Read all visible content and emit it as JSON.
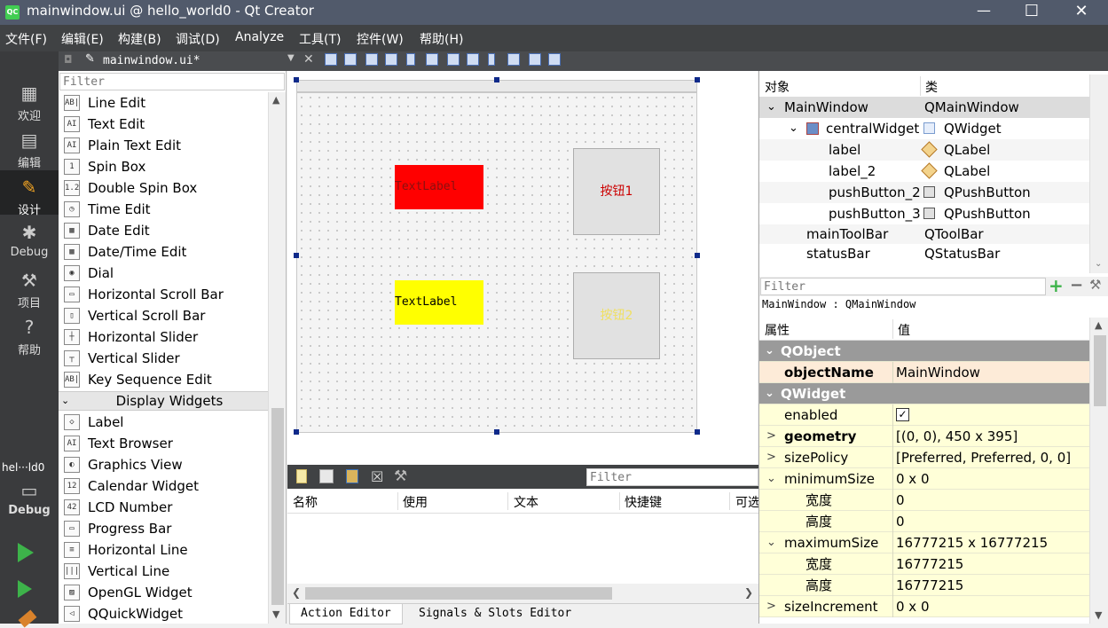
{
  "window": {
    "title": "mainwindow.ui @ hello_world0 - Qt Creator",
    "logo": "QC"
  },
  "menu": [
    "文件(F)",
    "编辑(E)",
    "构建(B)",
    "调试(D)",
    "Analyze",
    "工具(T)",
    "控件(W)",
    "帮助(H)"
  ],
  "modes": [
    {
      "label": "欢迎",
      "icon": "grid-icon"
    },
    {
      "label": "编辑",
      "icon": "document-icon"
    },
    {
      "label": "设计",
      "icon": "pencil-icon"
    },
    {
      "label": "Debug",
      "icon": "bug-icon"
    },
    {
      "label": "项目",
      "icon": "wrench-icon"
    },
    {
      "label": "帮助",
      "icon": "help-icon"
    }
  ],
  "session": {
    "name": "hel···ld0",
    "mode": "Debug"
  },
  "file_tab": {
    "name": "mainwindow.ui*"
  },
  "widgetbox": {
    "filter_placeholder": "Filter",
    "items": [
      {
        "label": "Line Edit",
        "icon": "AB|"
      },
      {
        "label": "Text Edit",
        "icon": "AI"
      },
      {
        "label": "Plain Text Edit",
        "icon": "AI"
      },
      {
        "label": "Spin Box",
        "icon": "1"
      },
      {
        "label": "Double Spin Box",
        "icon": "1.2"
      },
      {
        "label": "Time Edit",
        "icon": "◷"
      },
      {
        "label": "Date Edit",
        "icon": "▦"
      },
      {
        "label": "Date/Time Edit",
        "icon": "▦"
      },
      {
        "label": "Dial",
        "icon": "◉"
      },
      {
        "label": "Horizontal Scroll Bar",
        "icon": "▭"
      },
      {
        "label": "Vertical Scroll Bar",
        "icon": "▯"
      },
      {
        "label": "Horizontal Slider",
        "icon": "┼"
      },
      {
        "label": "Vertical Slider",
        "icon": "┬"
      },
      {
        "label": "Key Sequence Edit",
        "icon": "AB|"
      }
    ],
    "section_title": "Display Widgets",
    "display_items": [
      {
        "label": "Label",
        "icon": "◇"
      },
      {
        "label": "Text Browser",
        "icon": "AI"
      },
      {
        "label": "Graphics View",
        "icon": "◐"
      },
      {
        "label": "Calendar Widget",
        "icon": "12"
      },
      {
        "label": "LCD Number",
        "icon": "42"
      },
      {
        "label": "Progress Bar",
        "icon": "▭"
      },
      {
        "label": "Horizontal Line",
        "icon": "≡"
      },
      {
        "label": "Vertical Line",
        "icon": "|||"
      },
      {
        "label": "OpenGL Widget",
        "icon": "▨"
      },
      {
        "label": "QQuickWidget",
        "icon": "◁"
      }
    ]
  },
  "form": {
    "label1": {
      "text": "TextLabel",
      "bg": "#ff0000"
    },
    "label2": {
      "text": "TextLabel",
      "bg": "#ffff00"
    },
    "button1": {
      "text": "按钮1"
    },
    "button2": {
      "text": "按钮2"
    }
  },
  "action_editor": {
    "filter_placeholder": "Filter",
    "columns": [
      "名称",
      "使用",
      "文本",
      "快捷键",
      "可选"
    ],
    "tabs": [
      "Action Editor",
      "Signals & Slots Editor"
    ]
  },
  "object_inspector": {
    "headers": [
      "对象",
      "类"
    ],
    "rows": [
      {
        "name": "MainWindow",
        "class": "QMainWindow",
        "icon": "",
        "indent": 0,
        "expander": "⌄"
      },
      {
        "name": "centralWidget",
        "class": "QWidget",
        "icon": "widget-icon",
        "indent": 1,
        "expander": "⌄"
      },
      {
        "name": "label",
        "class": "QLabel",
        "icon": "label-icon",
        "indent": 2,
        "expander": ""
      },
      {
        "name": "label_2",
        "class": "QLabel",
        "icon": "label-icon",
        "indent": 2,
        "expander": ""
      },
      {
        "name": "pushButton_2",
        "class": "QPushButton",
        "icon": "button-icon",
        "indent": 2,
        "expander": ""
      },
      {
        "name": "pushButton_3",
        "class": "QPushButton",
        "icon": "button-icon",
        "indent": 2,
        "expander": ""
      },
      {
        "name": "mainToolBar",
        "class": "QToolBar",
        "icon": "",
        "indent": 1,
        "expander": ""
      },
      {
        "name": "statusBar",
        "class": "QStatusBar",
        "icon": "",
        "indent": 1,
        "expander": ""
      }
    ]
  },
  "property_editor": {
    "filter_placeholder": "Filter",
    "context": "MainWindow : QMainWindow",
    "headers": [
      "属性",
      "值"
    ],
    "rows": [
      {
        "kind": "group",
        "name": "QObject",
        "value": ""
      },
      {
        "kind": "prop",
        "name": "objectName",
        "value": "MainWindow",
        "bold": true,
        "style": "sel"
      },
      {
        "kind": "group",
        "name": "QWidget",
        "value": ""
      },
      {
        "kind": "prop",
        "name": "enabled",
        "value": "✓",
        "style": "yl",
        "checkbox": true
      },
      {
        "kind": "prop",
        "name": "geometry",
        "value": "[(0, 0), 450 x 395]",
        "bold": true,
        "expander": ">",
        "style": "yl"
      },
      {
        "kind": "prop",
        "name": "sizePolicy",
        "value": "[Preferred, Preferred, 0, 0]",
        "expander": ">",
        "style": "yl"
      },
      {
        "kind": "prop",
        "name": "minimumSize",
        "value": "0 x 0",
        "expander": "⌄",
        "style": "yl"
      },
      {
        "kind": "sub",
        "name": "宽度",
        "value": "0",
        "style": "yl"
      },
      {
        "kind": "sub",
        "name": "高度",
        "value": "0",
        "style": "yl"
      },
      {
        "kind": "prop",
        "name": "maximumSize",
        "value": "16777215 x 16777215",
        "expander": "⌄",
        "style": "yl"
      },
      {
        "kind": "sub",
        "name": "宽度",
        "value": "16777215",
        "style": "yl"
      },
      {
        "kind": "sub",
        "name": "高度",
        "value": "16777215",
        "style": "yl"
      },
      {
        "kind": "prop",
        "name": "sizeIncrement",
        "value": "0 x 0",
        "expander": ">",
        "style": "yl"
      }
    ]
  },
  "colors": {
    "title_bar": "#515a6b",
    "menu_bar": "#404244",
    "mode_bar": "#3a3b3d",
    "group_header": "#9a9a9a",
    "prop_row": "#ffffd8",
    "handle": "#0f2a8a",
    "run_green": "#3db34a"
  }
}
